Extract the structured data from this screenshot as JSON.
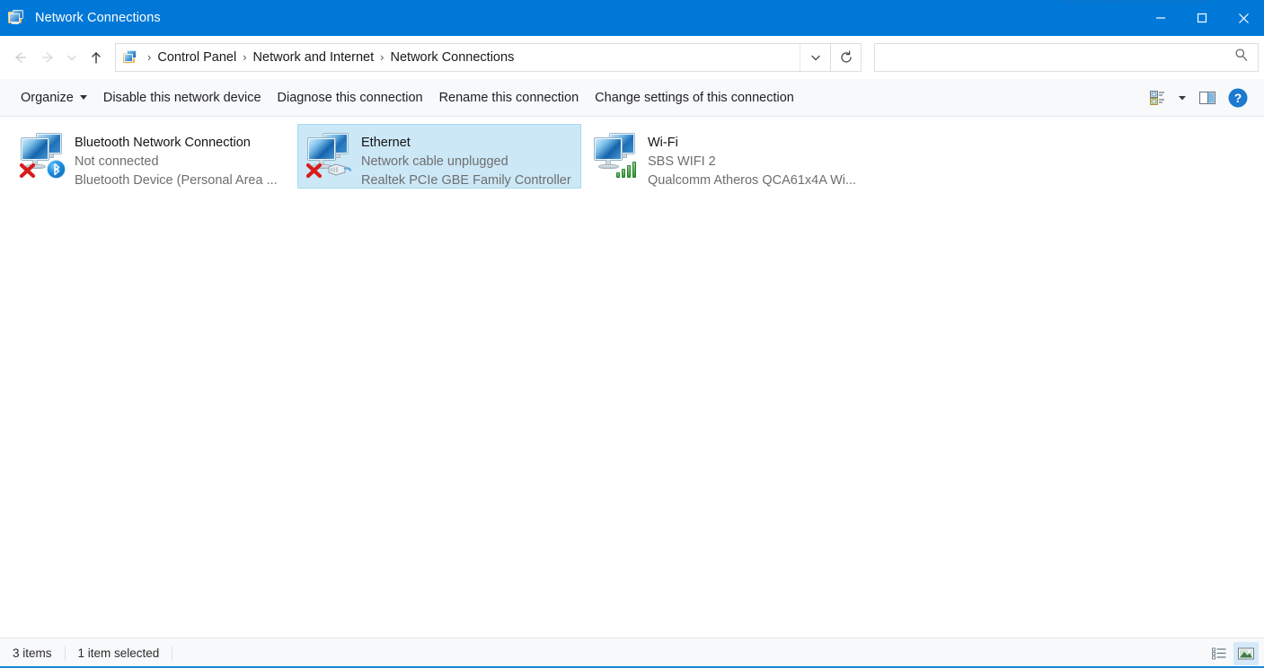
{
  "window": {
    "title": "Network Connections",
    "title_icon": "network-folder-icon",
    "accent_color": "#0078d7",
    "selection_color": "#cce8f7",
    "controls": {
      "minimize": "minimize-icon",
      "maximize": "maximize-icon",
      "close": "close-icon"
    }
  },
  "navbar": {
    "back": "back-arrow-icon",
    "forward": "forward-arrow-icon",
    "recent": "recent-locations-chevron-icon",
    "up": "up-arrow-icon",
    "address_icon": "network-folder-icon",
    "breadcrumbs": [
      {
        "label": "Control Panel"
      },
      {
        "label": "Network and Internet"
      },
      {
        "label": "Network Connections"
      }
    ],
    "separator": "›",
    "dropdown": "chevron-down-icon",
    "refresh": "refresh-icon",
    "search": {
      "value": "",
      "placeholder": "",
      "icon": "search-icon"
    }
  },
  "toolbar": {
    "organize_label": "Organize",
    "items": [
      {
        "label": "Disable this network device"
      },
      {
        "label": "Diagnose this connection"
      },
      {
        "label": "Rename this connection"
      },
      {
        "label": "Change settings of this connection"
      }
    ],
    "view_options_icon": "view-options-icon",
    "view_dropdown_icon": "chevron-down-icon",
    "preview_pane_icon": "preview-pane-icon",
    "help_icon": "help-icon"
  },
  "connections": [
    {
      "name": "Bluetooth Network Connection",
      "status": "Not connected",
      "device": "Bluetooth Device (Personal Area ...",
      "icon": "bluetooth-network-adapter-icon",
      "badge": "bluetooth-badge-icon",
      "disconnected": true,
      "selected": false
    },
    {
      "name": "Ethernet",
      "status": "Network cable unplugged",
      "device": "Realtek PCIe GBE Family Controller",
      "icon": "ethernet-adapter-icon",
      "badge": "rj45-cable-icon",
      "disconnected": true,
      "selected": true
    },
    {
      "name": "Wi-Fi",
      "status": "SBS WIFI 2",
      "device": "Qualcomm Atheros QCA61x4A Wi...",
      "icon": "wifi-adapter-icon",
      "badge": "signal-bars-icon",
      "disconnected": false,
      "selected": false
    }
  ],
  "statusbar": {
    "item_count": "3 items",
    "selection_count": "1 item selected",
    "details_view_icon": "details-view-icon",
    "large_icons_view_icon": "large-icons-view-icon"
  }
}
